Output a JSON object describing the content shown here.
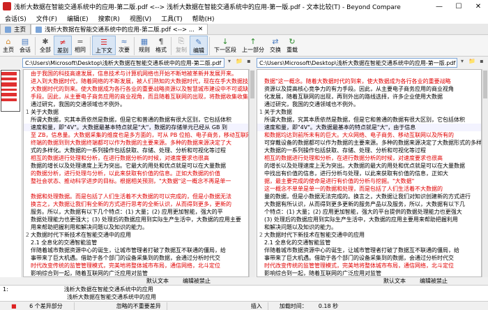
{
  "window": {
    "title": "浅析大数据在智能交通系统中的应用-第二版.pdf <--> 浅析大数据在智能交通系统中的应用-第一版.pdf - 文本比较(T) - Beyond Compare",
    "min": "—",
    "max": "☐",
    "close": "✕"
  },
  "menu": [
    "会话(S)",
    "文件(F)",
    "编辑(E)",
    "搜索(R)",
    "视图(V)",
    "工具(T)",
    "帮助(H)"
  ],
  "tabs": [
    {
      "label": "主页"
    },
    {
      "label": "浅析大数据在智能交通系统中的应用-第二版.pdf <--> ...",
      "close": "✕"
    }
  ],
  "toolbar": [
    {
      "label": "主页",
      "glyph": "⌂"
    },
    {
      "label": "会话",
      "glyph": "▤"
    },
    {
      "label": "全部",
      "glyph": "✱"
    },
    {
      "label": "差别",
      "glyph": "≠"
    },
    {
      "label": "相同",
      "glyph": "="
    },
    {
      "label": "上下文",
      "glyph": "☰"
    },
    {
      "label": "次要",
      "glyph": "≈"
    },
    {
      "label": "规则",
      "glyph": "▦"
    },
    {
      "label": "格式",
      "glyph": "¶"
    },
    {
      "label": "复制",
      "glyph": "⎘"
    },
    {
      "label": "编辑",
      "glyph": "✎"
    },
    {
      "label": "下一区段",
      "glyph": "↓"
    },
    {
      "label": "上一部分",
      "glyph": "↑"
    },
    {
      "label": "交换",
      "glyph": "⇄"
    },
    {
      "label": "重载",
      "glyph": "↻"
    }
  ],
  "left": {
    "path": "C:\\Users\\Microsoft\\Desktop\\浅析大数据在智能交通系统中的应用-第二版.pdf",
    "lines": [
      {
        "g": "",
        "t": "由于我国的科技高速发展，信息技术与计算机网络也开始不断地被革新并发展开来。",
        "k": "diff"
      },
      {
        "g": "",
        "t": "进入到大数据时代，随着网络的不断发展，被人们熟知的大数据时代，现在在手大数据技术",
        "k": "diff"
      },
      {
        "g": "",
        "t": "大数据时代的到来。使大数据成为各行各业的重要战略资源以及智慧城市建设中不可或缺",
        "k": "diff"
      },
      {
        "g": "",
        "t": "手段。因此，从主要电子商务应用的商业视角，而且随着互联网的出现，将数据收集收集越来越多",
        "k": "diff"
      },
      {
        "g": "",
        "t": "通过研究，我国的交通领域也不例外。",
        "k": ""
      },
      {
        "g": "1",
        "t": "关于大数据",
        "k": ""
      },
      {
        "g": "",
        "t": "所谓大数据，究其本质依然是数据，但是它和普通的数据有很大区别，它包括体积",
        "k": ""
      },
      {
        "g": "",
        "t": "速度和量，即\"4V\"。大数据最基本特点就是\"大\"，数据的存储单元已经从 GB 到",
        "k": "sub"
      },
      {
        "g": "",
        "t": "至 ZB，信息量。大数据采集的维度也是多方面的，可从 PB 位拍、电子商务，移动互联网",
        "k": "diff"
      },
      {
        "g": "",
        "t": "终端的数据到到大数据终端都可以作为数据的主要来源。多种的数据来源决定了大",
        "k": "diff"
      },
      {
        "g": "",
        "t": "式的多样化。大数据的一系列操作包括获取、存储、处理、分析和可视化等过程",
        "k": ""
      },
      {
        "g": "",
        "t": "相互的数据进行处理和分析，在进行数据分析的时候，对速度要求也很高",
        "k": "diff"
      },
      {
        "g": "",
        "t": "数据的增长以及处理速度上无为突出。它最大的用处和优点就是可以在大量数据",
        "k": ""
      },
      {
        "g": "",
        "t": "的数据分析，进行处理与分析，以此来获取有价值的信息。正如大数据的价值",
        "k": "diff"
      },
      {
        "g": "",
        "t": "整社会状态、推动科学进步的目标。根据相关预测，\"大数据\"这一概念不再是单一",
        "k": "diff"
      },
      {
        "g": "",
        "t": "",
        "k": ""
      },
      {
        "g": "",
        "t": "数据和处理数据。而是包括了人们生活着不大数据的可以完成的，但是小数据无法",
        "k": "diff"
      },
      {
        "g": "",
        "t": "换言之，大数据让我们有全新的方式进行思考的全新认识，从而得到更多，更新的",
        "k": "diff"
      },
      {
        "g": "",
        "t": "服务。所以，大数据有以下几个特点：(1) 大量；(2) 应用更加智能，强大的平",
        "k": ""
      },
      {
        "g": "",
        "t": "数据处理能力也更强大；(3) 处理后的数据应用到实际生产生活中，大数据的应用主要",
        "k": ""
      },
      {
        "g": "",
        "t": "用来帮助把握利用和解决问题以及知识的能力。",
        "k": ""
      },
      {
        "g": "2",
        "t": "大数据时代下新技术在智能交通中的应用",
        "k": ""
      },
      {
        "g": "",
        "t": "2.1 全息化的交通智能监管",
        "k": ""
      },
      {
        "g": "",
        "t": "伴随着城市数据资源中心的诞生，让城市管理者打破了数据互不联通的僵局，给",
        "k": ""
      },
      {
        "g": "",
        "t": "事带来了巨大机遇。借助于各个部门的设备采集到的数据，会通过分析时代交",
        "k": ""
      },
      {
        "g": "",
        "t": "时代改变传统的监管管理模式，完美地将整体城市布局，通信网络，北斗定位",
        "k": "diff"
      },
      {
        "g": "",
        "t": "影响综合到一起，随着互联网的广泛应用对监管",
        "k": ""
      },
      {
        "g": "",
        "t": "",
        "k": ""
      },
      {
        "g": "",
        "t": "等都利用大数据进行了全体全面的关系。通过于传统的发展模式，还可以利用大数据",
        "k": "diff"
      },
      {
        "g": "",
        "t": "能是持各民族语言以及方言等系统融合，在语音信号处理的支持下，可以对人的",
        "k": ""
      },
      {
        "g": "",
        "t": "",
        "k": ""
      }
    ],
    "status": {
      "encoding": "默认文本",
      "mode": "编辑被禁止"
    }
  },
  "right": {
    "path": "C:\\Users\\Microsoft\\Desktop\\浅析大数据在智能交通系统中的应用-第一版.pdf",
    "lines": [
      {
        "g": "",
        "t": "",
        "k": ""
      },
      {
        "g": "",
        "t": "数据\"这一概念。随着大数据时代的到来，使大数据成为各行各业的重要战略",
        "k": "diff"
      },
      {
        "g": "",
        "t": "资源以及提高核心竞争力的有力手段。因此，从主要电子商务应用的商业视角",
        "k": ""
      },
      {
        "g": "",
        "t": "化发展，随着互联网的出现，再到外出的路线选择，许多企业使用大数据",
        "k": ""
      },
      {
        "g": "",
        "t": "通过研究，我国的交通领域也不例外。",
        "k": ""
      },
      {
        "g": "1",
        "t": "关于大数据",
        "k": ""
      },
      {
        "g": "",
        "t": "所谓大数据，究其本质依然是数据，但是它和普通的数据有很大区别，它包括体积",
        "k": ""
      },
      {
        "g": "",
        "t": "速度和量，即\"4V\"。大数据最基本的特点就是\"大\"，由于信息",
        "k": "sub"
      },
      {
        "g": "",
        "t": "和数据均达到前所未有的巨大。大众网络、电子商务、移动互联网以及所有的",
        "k": "diff"
      },
      {
        "g": "",
        "t": "可穿戴设备的数据都可以作为数据的主要来源。多种的数据来源决定了大数据形式的多样化。",
        "k": ""
      },
      {
        "g": "",
        "t": "大数据的一系列操作包括获取、存储、处理、分析和可视化等过程",
        "k": ""
      },
      {
        "g": "",
        "t": "相互的数据进行处理和分析，在进行数据分析的时候，对速度要求也很高",
        "k": "diff"
      },
      {
        "g": "",
        "t": "的增长以及处理速度上无为突出。大数据的最大的用处和优点就是可以在大量数据",
        "k": ""
      },
      {
        "g": "",
        "t": "中找出有价值的信息，进行分析与处理，以此来获取有价值的信息，正如大",
        "k": ""
      },
      {
        "g": "",
        "t": "据，最主要完成的使命是进行有价值的分析与挖掘。\"大数据\"",
        "k": "diff"
      },
      {
        "g": "",
        "t": "这一概念不单单是单一的数据和处理，而是包括了人们生活着不大数据的",
        "k": "diff"
      },
      {
        "g": "",
        "t": "量的数据，但是小数据无法完成的。换言之，大数据让我们对知识创建新的方式进行",
        "k": ""
      },
      {
        "g": "",
        "t": "大数据有所认识，从而得到更多更新的服务产品以及服务，所以，大数据有以下几",
        "k": ""
      },
      {
        "g": "",
        "t": "个特点：(1) 大量；(2) 应用更加智能，强大的平台提供的数据处理能力也更强大",
        "k": ""
      },
      {
        "g": "",
        "t": "(3) 处理后的数据应用到实际生产生活中，大数据的应用主要用来帮助把握利用",
        "k": ""
      },
      {
        "g": "",
        "t": "和解决问题以及知识的能力。",
        "k": ""
      },
      {
        "g": "2",
        "t": "大数据时代下新技术在智能交通中的应用",
        "k": ""
      },
      {
        "g": "",
        "t": "2.1 全息化的交通智能监管",
        "k": ""
      },
      {
        "g": "",
        "t": "伴随着城市数据资源中心的诞生，让城市管理者打破了数据互不联通的僵局，给",
        "k": ""
      },
      {
        "g": "",
        "t": "事带来了巨大机遇。借助于各个部门的设备采集到的数据，会通过分析时代交",
        "k": ""
      },
      {
        "g": "",
        "t": "时代改变传统的监管管理模式，完美地将整体城市布局，通信网络，北斗定位",
        "k": "diff"
      },
      {
        "g": "",
        "t": "影响综合到一起，随着互联网的广泛应用对监管",
        "k": ""
      },
      {
        "g": "",
        "t": "",
        "k": ""
      },
      {
        "g": "",
        "t": "等都利用大数据进行了全体全面的关系。通过于传统的发展模式，还可以利用大数据",
        "k": "diff"
      },
      {
        "g": "",
        "t": "能是持各民族语言以及方言等系统融合，在语音信号处理的支持下，可以对人的",
        "k": ""
      },
      {
        "g": "",
        "t": "",
        "k": ""
      }
    ],
    "status": {
      "encoding": "默认文本",
      "mode": "编辑被禁止"
    }
  },
  "detail": {
    "line1_num": "1:",
    "line1": "浅析大数据在智能交通系统中的应用",
    "line2": "浅析大数据在智能交通系统中的应用"
  },
  "statusbar": {
    "diffs": "6 个差异部分",
    "ignore": "忽略的不重要差异",
    "insert": "插入",
    "loadtime": "加载时间：",
    "loadtime_val": "0.18 秒"
  }
}
